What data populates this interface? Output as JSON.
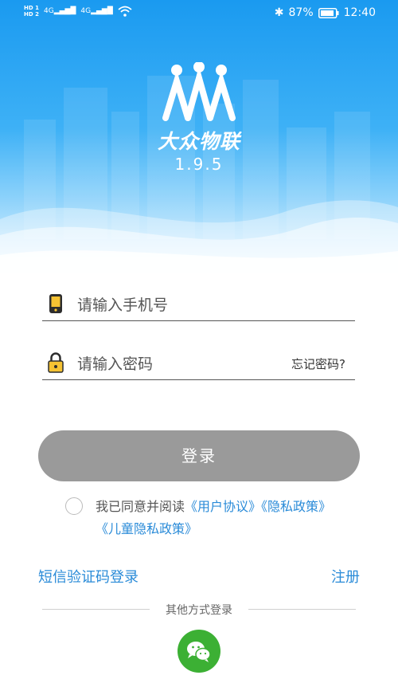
{
  "status_bar": {
    "hd_top": "HD 1",
    "hd_bottom": "HD 2",
    "signal_1": "4G",
    "signal_2": "4G",
    "battery_percent": "87%",
    "time": "12:40"
  },
  "brand": {
    "name": "大众物联",
    "version": "1.9.5"
  },
  "login_form": {
    "phone_placeholder": "请输入手机号",
    "password_placeholder": "请输入密码",
    "forgot_password": "忘记密码?",
    "login_button": "登录"
  },
  "agreement": {
    "prefix": "我已同意并阅读",
    "user_agreement": "《用户协议》",
    "privacy_policy": "《隐私政策》",
    "child_privacy_policy": "《儿童隐私政策》",
    "checked": false
  },
  "footer": {
    "sms_login": "短信验证码登录",
    "register": "注册",
    "other_login": "其他方式登录",
    "wechat_icon": "wechat-icon"
  },
  "colors": {
    "hero_blue": "#1a9af0",
    "link_blue": "#2a8bd8",
    "button_gray": "#9a9a9a",
    "wechat_green": "#3cb034"
  }
}
